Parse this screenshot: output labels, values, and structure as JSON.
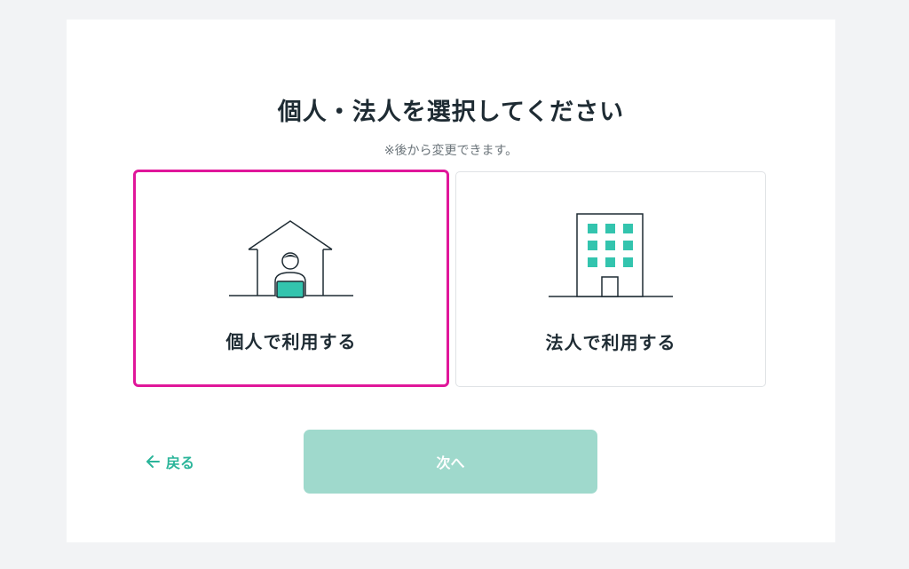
{
  "heading": {
    "title": "個人・法人を選択してください",
    "subtitle": "※後から変更できます。"
  },
  "options": [
    {
      "label": "個人で利用する",
      "icon": "house-person-laptop-icon",
      "selected": true
    },
    {
      "label": "法人で利用する",
      "icon": "office-building-icon",
      "selected": false
    }
  ],
  "footer": {
    "back_label": "戻る",
    "back_icon": "arrow-left-icon",
    "next_label": "次へ"
  },
  "colors": {
    "accent": "#2bb59a",
    "selected_border": "#e0169a",
    "next_button_disabled": "#9fd9cc",
    "icon_fill": "#33c4ae",
    "text": "#1e2b33"
  }
}
